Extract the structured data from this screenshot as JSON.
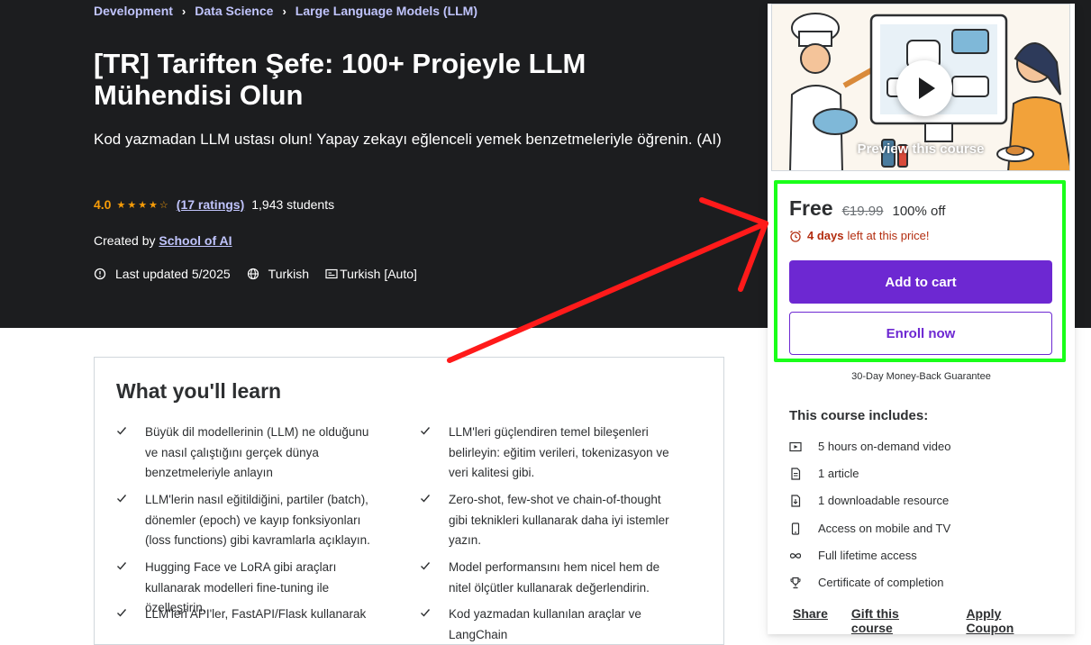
{
  "breadcrumb": [
    "Development",
    "Data Science",
    "Large Language Models (LLM)"
  ],
  "course": {
    "title": "[TR] Tariften Şefe: 100+ Projeyle LLM Mühendisi Olun",
    "subtitle": "Kod yazmadan LLM ustası olun! Yapay zekayı eğlenceli yemek benzetmeleriyle öğrenin. (AI)",
    "rating": "4.0",
    "rating_value": 4.0,
    "ratings_count": "(17 ratings)",
    "students": "1,943 students",
    "created_by_label": "Created by",
    "instructor": "School of AI",
    "last_updated": "Last updated 5/2025",
    "language": "Turkish",
    "captions": "Turkish [Auto]"
  },
  "learn": {
    "title": "What you'll learn",
    "items": [
      "Büyük dil modellerinin (LLM) ne olduğunu ve nasıl çalıştığını gerçek dünya benzetmeleriyle anlayın",
      "LLM'leri güçlendiren temel bileşenleri belirleyin: eğitim verileri, tokenizasyon ve veri kalitesi gibi.",
      "LLM'lerin nasıl eğitildiğini, partiler (batch), dönemler (epoch) ve kayıp fonksiyonları (loss functions) gibi kavramlarla açıklayın.",
      "Zero-shot, few-shot ve chain-of-thought gibi teknikleri kullanarak daha iyi istemler yazın.",
      "Hugging Face ve LoRA gibi araçları kullanarak modelleri fine-tuning ile özelleştirin.",
      "Model performansını hem nicel hem de nitel ölçütler kullanarak değerlendirin.",
      "LLM'leri API'ler, FastAPI/Flask kullanarak",
      "Kod yazmadan kullanılan araçlar ve LangChain"
    ]
  },
  "sidebar": {
    "preview_label": "Preview this course",
    "price_free": "Free",
    "price_old": "€19.99",
    "discount": "100% off",
    "deadline_days": "4 days",
    "deadline_rest": "left at this price!",
    "add_to_cart": "Add to cart",
    "enroll_now": "Enroll now",
    "guarantee": "30-Day Money-Back Guarantee",
    "includes_title": "This course includes:",
    "includes": [
      {
        "icon": "video-icon",
        "label": "5 hours on-demand video"
      },
      {
        "icon": "article-icon",
        "label": "1 article"
      },
      {
        "icon": "download-icon",
        "label": "1 downloadable resource"
      },
      {
        "icon": "mobile-icon",
        "label": "Access on mobile and TV"
      },
      {
        "icon": "infinity-icon",
        "label": "Full lifetime access"
      },
      {
        "icon": "trophy-icon",
        "label": "Certificate of completion"
      }
    ],
    "links": [
      "Share",
      "Gift this course",
      "Apply Coupon"
    ]
  },
  "colors": {
    "hero_bg": "#1c1d1f",
    "accent_purple": "#6d28d2",
    "link_lavender": "#c0c4fc",
    "star_orange": "#f69c08",
    "deadline_red": "#b32d0f",
    "annotation_green": "#1aff1a",
    "annotation_red": "#ff1a1a"
  }
}
